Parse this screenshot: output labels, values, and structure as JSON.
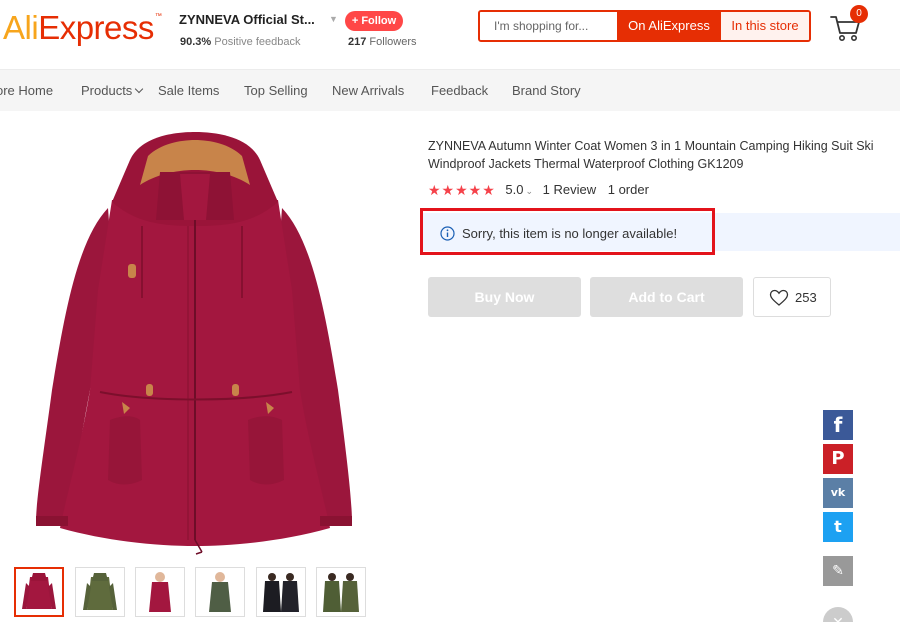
{
  "header": {
    "logo_ali": "Ali",
    "logo_express": "Express",
    "logo_tm": "™",
    "store_name": "ZYNNEVA Official St...",
    "follow_label": "+ Follow",
    "feedback_percent": "90.3%",
    "feedback_label": "Positive feedback",
    "followers_count": "217",
    "followers_label": "Followers",
    "search_placeholder": "I'm shopping for...",
    "search_on_ali": "On AliExpress",
    "search_in_store": "In this store",
    "cart_count": "0"
  },
  "nav": {
    "items": [
      "ore Home",
      "Products",
      "Sale Items",
      "Top Selling",
      "New Arrivals",
      "Feedback",
      "Brand Story"
    ]
  },
  "product": {
    "title": "ZYNNEVA Autumn Winter Coat Women 3 in 1 Mountain Camping Hiking Suit Ski Windproof Jackets Thermal Waterproof Clothing GK1209",
    "stars": "★★★★★",
    "rating": "5.0",
    "reviews": "1 Review",
    "orders": "1 order",
    "unavailable_message": "Sorry, this item is no longer available!",
    "buy_now_label": "Buy Now",
    "add_to_cart_label": "Add to Cart",
    "wishlist_count": "253",
    "rating_value": 5.0,
    "thumbnails_count": 6
  },
  "share": {
    "facebook": "f",
    "pinterest": "P",
    "vk": "vk",
    "twitter": "t",
    "edit": "✎",
    "close": "✕"
  },
  "colors": {
    "brand_red": "#e62e04",
    "brand_orange": "#f7a51c",
    "follow_red": "#ff4747",
    "coat_main": "#a3173f",
    "coat_lining": "#c8844a",
    "alert_border": "#e3131b",
    "disabled_button": "#dedede"
  }
}
